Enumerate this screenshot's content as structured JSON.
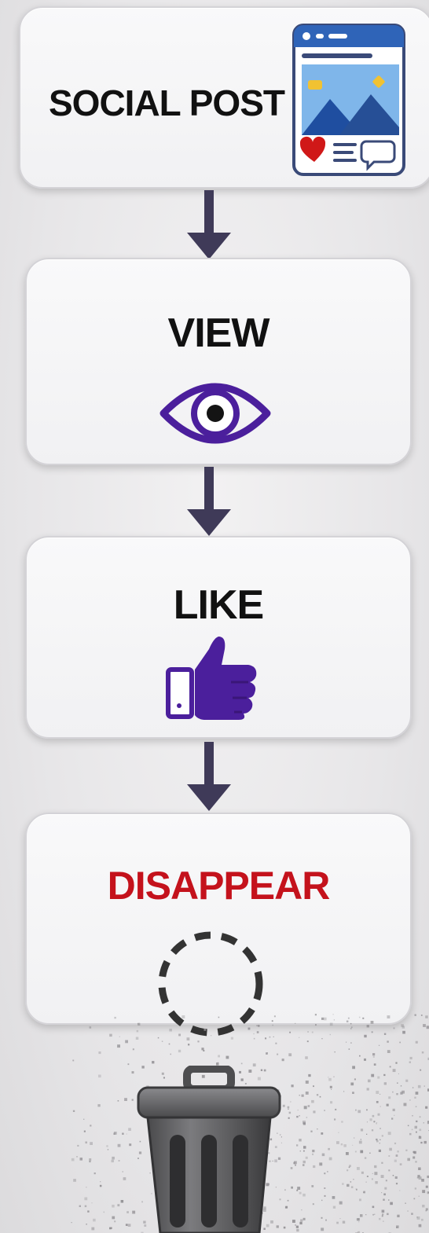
{
  "steps": {
    "social_post": {
      "label": "SOCIAL POST"
    },
    "view": {
      "label": "VIEW"
    },
    "like": {
      "label": "LIKE"
    },
    "disappear": {
      "label": "DISAPPEAR"
    }
  },
  "colors": {
    "purple": "#4b1f9c",
    "arrow": "#3f3a58",
    "red": "#c4121c",
    "blue": "#2f64b8",
    "text": "#111111"
  },
  "icons": [
    "social-post-thumbnail-icon",
    "eye-icon",
    "thumbs-up-icon",
    "dashed-circle-icon",
    "trash-can-icon"
  ]
}
